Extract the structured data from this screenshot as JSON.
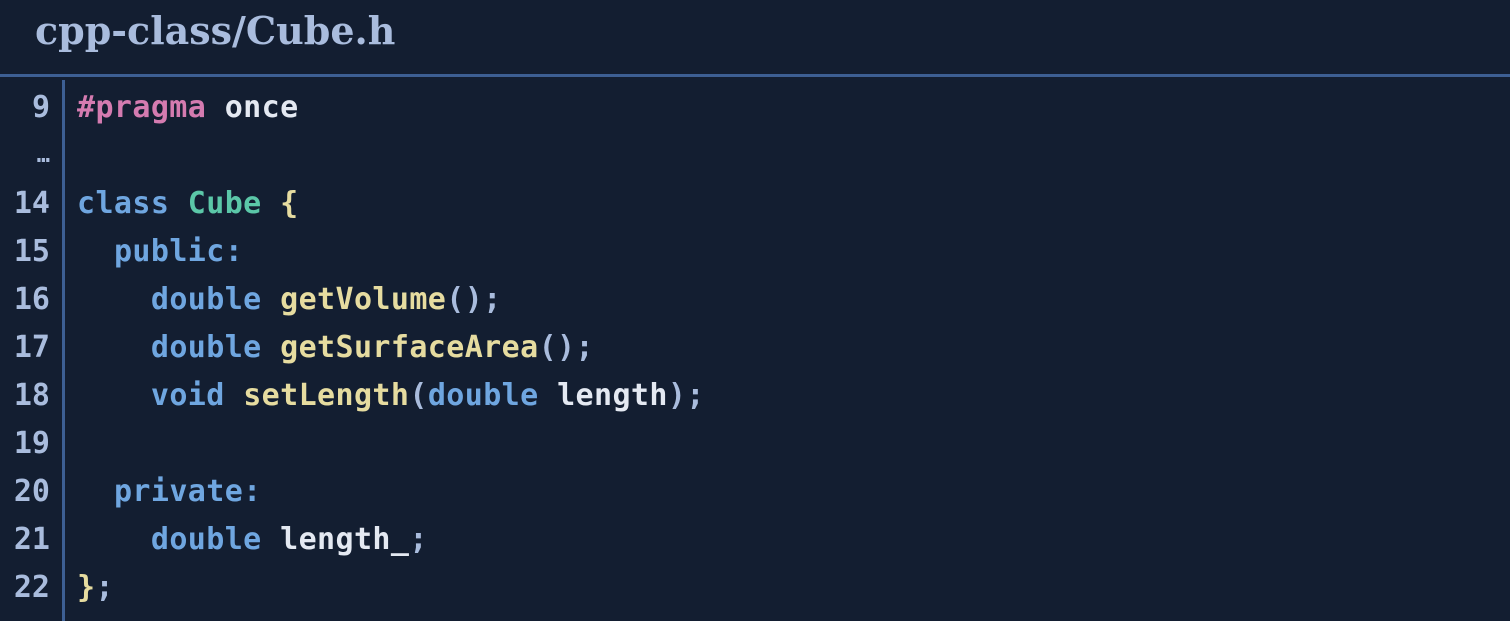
{
  "file": {
    "title": "cpp-class/Cube.h"
  },
  "colors": {
    "background": "#131e31",
    "divider": "#3d5f93",
    "line_number": "#a9bcdd",
    "preprocessor": "#d47bb0",
    "keyword": "#6fa6e0",
    "type_name": "#5bc7a8",
    "function": "#e6dca0",
    "identifier": "#e4e9f2"
  },
  "lines": [
    {
      "number": "9",
      "tokens": [
        {
          "text": "#pragma",
          "kind": "pre"
        },
        {
          "text": " ",
          "kind": "id"
        },
        {
          "text": "once",
          "kind": "id"
        }
      ]
    },
    {
      "number": "…",
      "tokens": []
    },
    {
      "number": "14",
      "tokens": [
        {
          "text": "class",
          "kind": "kw"
        },
        {
          "text": " ",
          "kind": "id"
        },
        {
          "text": "Cube",
          "kind": "type"
        },
        {
          "text": " ",
          "kind": "id"
        },
        {
          "text": "{",
          "kind": "brace"
        }
      ]
    },
    {
      "number": "15",
      "tokens": [
        {
          "text": "  ",
          "kind": "id"
        },
        {
          "text": "public:",
          "kind": "kw"
        }
      ]
    },
    {
      "number": "16",
      "tokens": [
        {
          "text": "    ",
          "kind": "id"
        },
        {
          "text": "double",
          "kind": "kw"
        },
        {
          "text": " ",
          "kind": "id"
        },
        {
          "text": "getVolume",
          "kind": "fn"
        },
        {
          "text": "()",
          "kind": "pun"
        },
        {
          "text": ";",
          "kind": "pun"
        }
      ]
    },
    {
      "number": "17",
      "tokens": [
        {
          "text": "    ",
          "kind": "id"
        },
        {
          "text": "double",
          "kind": "kw"
        },
        {
          "text": " ",
          "kind": "id"
        },
        {
          "text": "getSurfaceArea",
          "kind": "fn"
        },
        {
          "text": "()",
          "kind": "pun"
        },
        {
          "text": ";",
          "kind": "pun"
        }
      ]
    },
    {
      "number": "18",
      "tokens": [
        {
          "text": "    ",
          "kind": "id"
        },
        {
          "text": "void",
          "kind": "kw"
        },
        {
          "text": " ",
          "kind": "id"
        },
        {
          "text": "setLength",
          "kind": "fn"
        },
        {
          "text": "(",
          "kind": "pun"
        },
        {
          "text": "double",
          "kind": "kw"
        },
        {
          "text": " ",
          "kind": "id"
        },
        {
          "text": "length",
          "kind": "id"
        },
        {
          "text": ")",
          "kind": "pun"
        },
        {
          "text": ";",
          "kind": "pun"
        }
      ]
    },
    {
      "number": "19",
      "tokens": []
    },
    {
      "number": "20",
      "tokens": [
        {
          "text": "  ",
          "kind": "id"
        },
        {
          "text": "private:",
          "kind": "kw"
        }
      ]
    },
    {
      "number": "21",
      "tokens": [
        {
          "text": "    ",
          "kind": "id"
        },
        {
          "text": "double",
          "kind": "kw"
        },
        {
          "text": " ",
          "kind": "id"
        },
        {
          "text": "length_",
          "kind": "id"
        },
        {
          "text": ";",
          "kind": "pun"
        }
      ]
    },
    {
      "number": "22",
      "tokens": [
        {
          "text": "}",
          "kind": "brace"
        },
        {
          "text": ";",
          "kind": "pun"
        }
      ]
    }
  ]
}
